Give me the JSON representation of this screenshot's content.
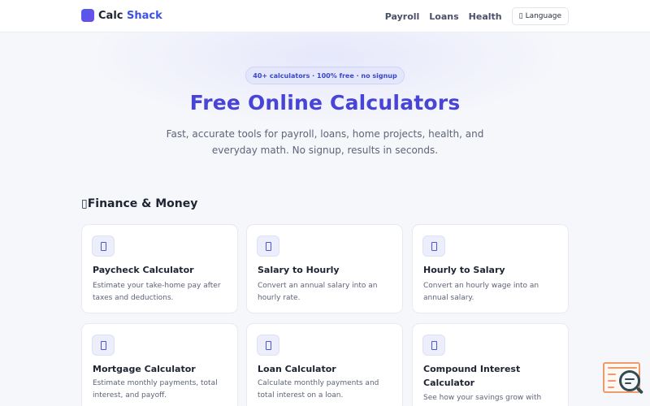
{
  "header": {
    "brand_part1": "Calc",
    "brand_part2": "Shack",
    "nav": [
      "Payroll",
      "Loans",
      "Health"
    ],
    "language_label": "Language",
    "language_icon": "globe-icon"
  },
  "hero": {
    "badge": "40+ calculators · 100% free · no signup",
    "title": "Free Online Calculators",
    "subtitle": "Fast, accurate tools for payroll, loans, home projects, health, and everyday math. No signup, results in seconds."
  },
  "section": {
    "title": "Finance & Money",
    "icon": "money-icon"
  },
  "cards": [
    {
      "title": "Paycheck Calculator",
      "desc": "Estimate your take-home pay after taxes and deductions.",
      "icon": "paycheck-icon"
    },
    {
      "title": "Salary to Hourly",
      "desc": "Convert an annual salary into an hourly rate.",
      "icon": "salary-icon"
    },
    {
      "title": "Hourly to Salary",
      "desc": "Convert an hourly wage into an annual salary.",
      "icon": "hourly-icon"
    },
    {
      "title": "Mortgage Calculator",
      "desc": "Estimate monthly payments, total interest, and payoff.",
      "icon": "house-icon"
    },
    {
      "title": "Loan Calculator",
      "desc": "Calculate monthly payments and total interest on a loan.",
      "icon": "loan-icon"
    },
    {
      "title": "Compound Interest Calculator",
      "desc": "See how your savings grow with",
      "icon": "chart-icon"
    }
  ],
  "colors": {
    "accent": "#4744d6",
    "brand": "#3f51e6",
    "widget": "#ef9a6a"
  }
}
